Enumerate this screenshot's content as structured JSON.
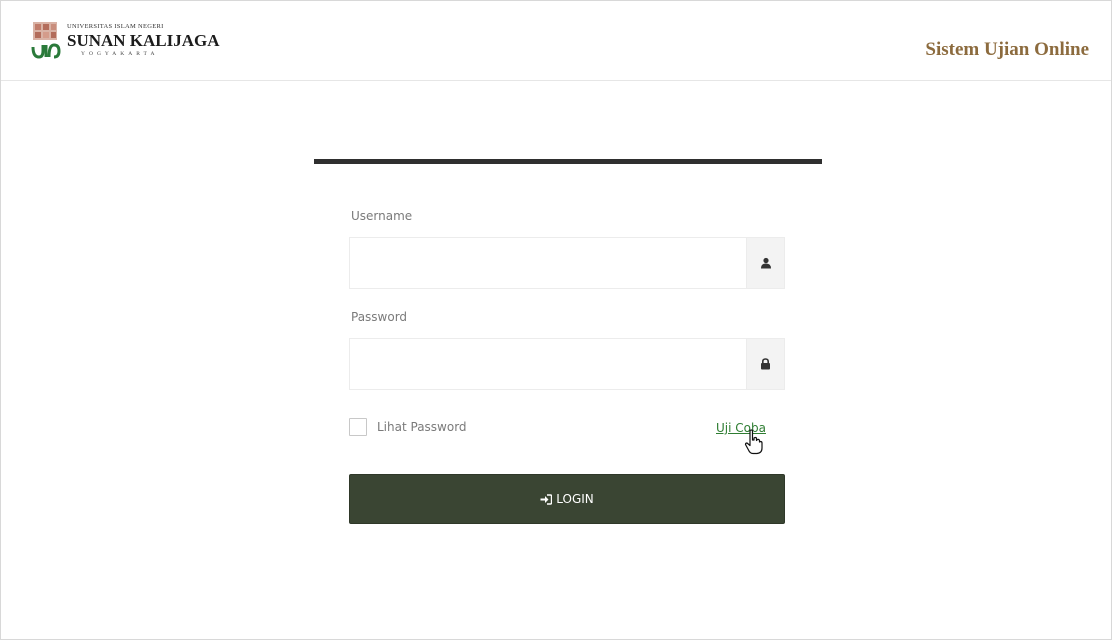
{
  "header": {
    "logo_university": "UNIVERSITAS ISLAM NEGERI",
    "logo_name": "SUNAN KALIJAGA",
    "logo_city": "YOGYAKARTA",
    "app_title": "Sistem Ujian Online"
  },
  "form": {
    "username": {
      "label": "Username",
      "value": "",
      "icon": "user-icon"
    },
    "password": {
      "label": "Password",
      "value": "",
      "icon": "lock-icon"
    },
    "show_password": {
      "label": "Lihat Password",
      "checked": false
    },
    "trial_link": "Uji Coba",
    "login_button": {
      "label": "LOGIN",
      "icon": "sign-in-icon"
    }
  },
  "colors": {
    "title": "#8c6b3e",
    "button": "#3a4533",
    "link": "#2e7d32",
    "rule": "#2f2f2f"
  }
}
